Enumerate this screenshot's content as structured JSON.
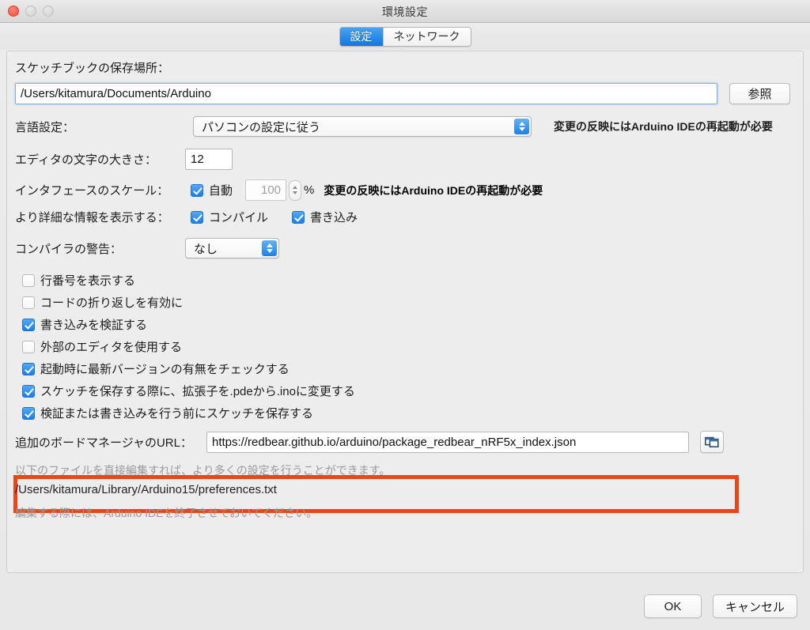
{
  "window": {
    "title": "環境設定",
    "traffic_lights": [
      "close",
      "minimize",
      "zoom"
    ]
  },
  "tabs": [
    {
      "label": "設定",
      "active": true
    },
    {
      "label": "ネットワーク",
      "active": false
    }
  ],
  "sketchbook": {
    "label": "スケッチブックの保存場所：",
    "value": "/Users/kitamura/Documents/Arduino",
    "browse_label": "参照"
  },
  "language": {
    "label": "言語設定：",
    "value": "パソコンの設定に従う",
    "note": "変更の反映にはArduino IDEの再起動が必要"
  },
  "editor_font": {
    "label": "エディタの文字の大きさ：",
    "value": "12"
  },
  "interface_scale": {
    "label": "インタフェースのスケール：",
    "auto_label": "自動",
    "auto_checked": true,
    "value": "100",
    "percent": "%",
    "note": "変更の反映にはArduino IDEの再起動が必要"
  },
  "verbose": {
    "label": "より詳細な情報を表示する：",
    "compile_label": "コンパイル",
    "compile_checked": true,
    "upload_label": "書き込み",
    "upload_checked": true
  },
  "compiler_warnings": {
    "label": "コンパイラの警告：",
    "value": "なし"
  },
  "options": [
    {
      "label": "行番号を表示する",
      "checked": false
    },
    {
      "label": "コードの折り返しを有効に",
      "checked": false
    },
    {
      "label": "書き込みを検証する",
      "checked": true
    },
    {
      "label": "外部のエディタを使用する",
      "checked": false
    },
    {
      "label": "起動時に最新バージョンの有無をチェックする",
      "checked": true
    },
    {
      "label": "スケッチを保存する際に、拡張子を.pdeから.inoに変更する",
      "checked": true
    },
    {
      "label": "検証または書き込みを行う前にスケッチを保存する",
      "checked": true
    }
  ],
  "board_manager_urls": {
    "label": "追加のボードマネージャのURL：",
    "value": "https://redbear.github.io/arduino/package_redbear_nRF5x_index.json",
    "button_icon": "windows-cascade-icon",
    "highlight_color": "#ec4414"
  },
  "footer_notes": {
    "line1": "以下のファイルを直接編集すれば、より多くの設定を行うことができます。",
    "line2": "/Users/kitamura/Library/Arduino15/preferences.txt",
    "line3": "編集する際には、Arduino IDEを終了させておいてください。"
  },
  "buttons": {
    "ok": "OK",
    "cancel": "キャンセル"
  }
}
